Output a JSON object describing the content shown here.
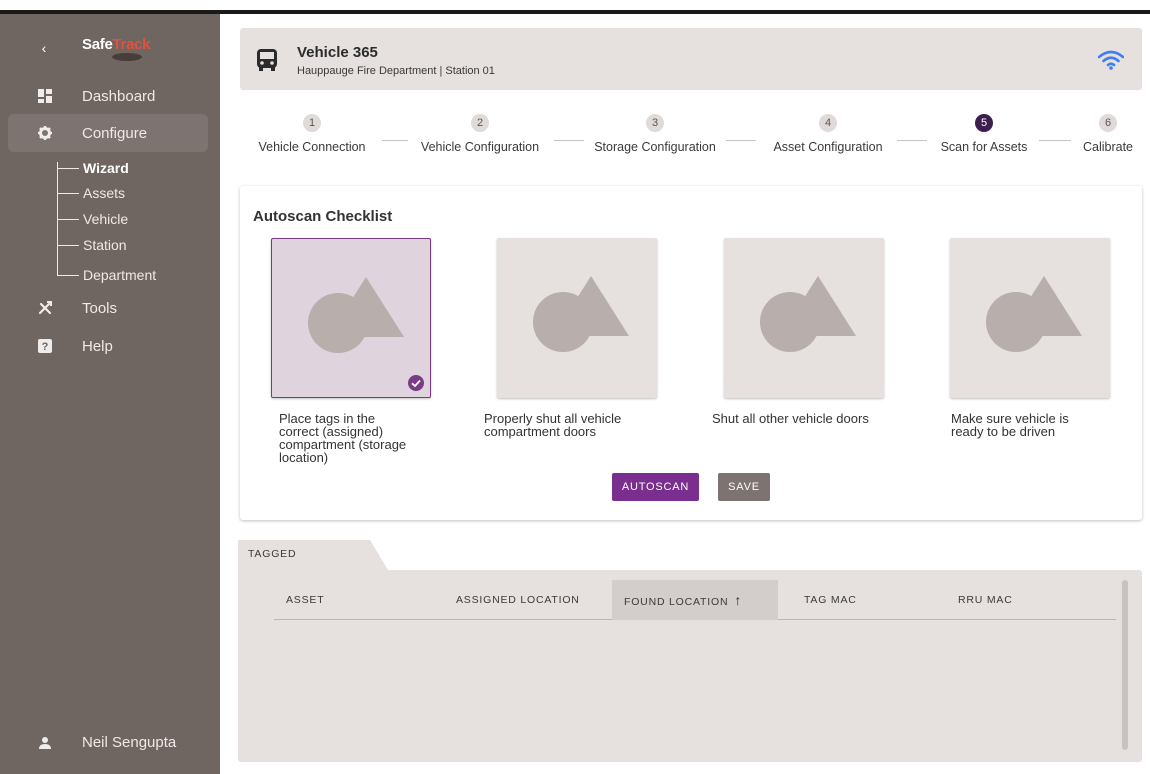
{
  "sidebar": {
    "logo_part1": "Safe",
    "logo_part2": "Track",
    "collapse_glyph": "‹",
    "items": [
      {
        "label": "Dashboard",
        "icon": "dashboard-icon"
      },
      {
        "label": "Configure",
        "icon": "gear-icon"
      },
      {
        "label": "Tools",
        "icon": "tools-icon"
      },
      {
        "label": "Help",
        "icon": "help-icon"
      }
    ],
    "configure_sub": [
      {
        "label": "Wizard"
      },
      {
        "label": "Assets"
      },
      {
        "label": "Vehicle"
      },
      {
        "label": "Station"
      },
      {
        "label": "Department"
      }
    ],
    "user_name": "Neil Sengupta"
  },
  "vehicle": {
    "title": "Vehicle 365",
    "subtitle": "Hauppauge Fire Department | Station 01"
  },
  "stepper": {
    "active_step": 5,
    "steps": [
      {
        "num": "1",
        "label": "Vehicle Connection"
      },
      {
        "num": "2",
        "label": "Vehicle Configuration"
      },
      {
        "num": "3",
        "label": "Storage Configuration"
      },
      {
        "num": "4",
        "label": "Asset Configuration"
      },
      {
        "num": "5",
        "label": "Scan for Assets"
      },
      {
        "num": "6",
        "label": "Calibrate"
      }
    ]
  },
  "checklist": {
    "title": "Autoscan Checklist",
    "items": [
      {
        "caption": "Place tags in the correct (assigned) compartment (storage location)",
        "checked": true
      },
      {
        "caption": "Properly shut all vehicle compartment doors",
        "checked": false
      },
      {
        "caption": "Shut all other vehicle doors",
        "checked": false
      },
      {
        "caption": "Make sure vehicle is ready to be driven",
        "checked": false
      }
    ],
    "autoscan_label": "AUTOSCAN",
    "save_label": "SAVE"
  },
  "tagged": {
    "tab_label": "TAGGED",
    "columns": [
      "ASSET",
      "ASSIGNED LOCATION",
      "FOUND LOCATION",
      "TAG MAC",
      "RRU MAC"
    ],
    "sort_column": "FOUND LOCATION",
    "sort_direction": "ascending",
    "rows": []
  },
  "colors": {
    "sidebar_bg": "#6f6561",
    "accent_purple": "#7a2e8d",
    "active_step": "#3d1f4f",
    "panel_bg": "#e6e0de",
    "wifi_blue": "#3d7ef7",
    "logo_red": "#e2513d"
  }
}
